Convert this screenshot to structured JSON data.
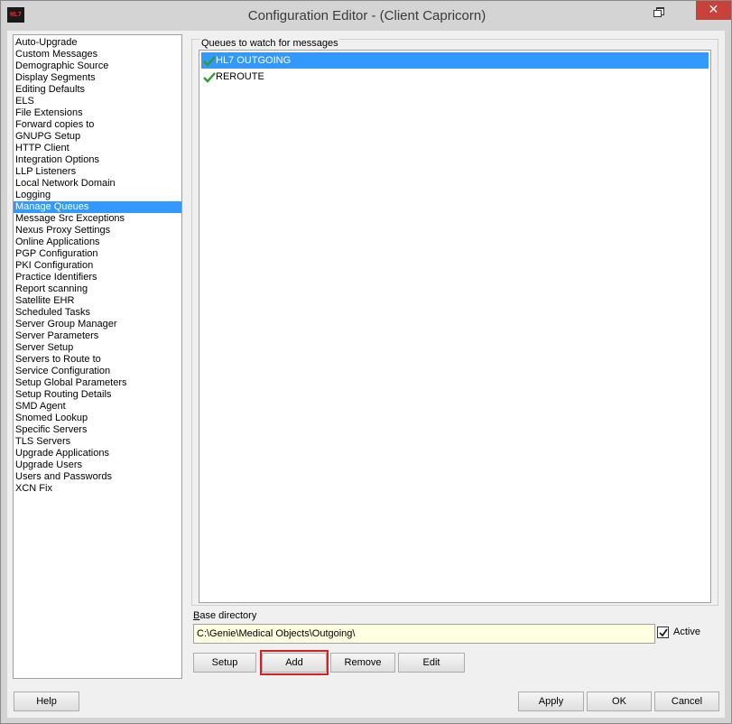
{
  "window": {
    "title": "Configuration Editor -  (Client Capricorn)",
    "app_icon_text": "HL7",
    "close_glyph": "✕"
  },
  "sidebar": {
    "selected_index": 14,
    "items": [
      "Auto-Upgrade",
      "Custom Messages",
      "Demographic Source",
      "Display Segments",
      "Editing Defaults",
      "ELS",
      "File Extensions",
      "Forward copies to",
      "GNUPG Setup",
      "HTTP Client",
      "Integration Options",
      "LLP Listeners",
      "Local Network Domain",
      "Logging",
      "Manage Queues",
      "Message Src Exceptions",
      "Nexus Proxy Settings",
      "Online Applications",
      "PGP Configuration",
      "PKI Configuration",
      "Practice Identifiers",
      "Report scanning",
      "Satellite EHR",
      "Scheduled Tasks",
      "Server Group Manager",
      "Server Parameters",
      "Server Setup",
      "Servers to Route to",
      "Service Configuration",
      "Setup Global Parameters",
      "Setup Routing Details",
      "SMD Agent",
      "Snomed Lookup",
      "Specific Servers",
      "TLS Servers",
      "Upgrade Applications",
      "Upgrade Users",
      "Users and Passwords",
      "XCN Fix"
    ]
  },
  "queues": {
    "group_label": "Queues to watch for messages",
    "items": [
      {
        "label": "HL7 OUTGOING",
        "checked": true,
        "selected": true
      },
      {
        "label": "REROUTE",
        "checked": true,
        "selected": false
      }
    ]
  },
  "base_directory": {
    "label_first": "B",
    "label_rest": "ase directory",
    "value": "C:\\Genie\\Medical Objects\\Outgoing\\",
    "active_label": "Active",
    "active_checked": true
  },
  "actions": {
    "setup": "Setup",
    "add": "Add",
    "remove": "Remove",
    "edit": "Edit"
  },
  "footer": {
    "help": "Help",
    "apply": "Apply",
    "ok": "OK",
    "cancel": "Cancel"
  },
  "colors": {
    "selection": "#3399ff",
    "input_bg": "#ffffe1",
    "close_button": "#c7423a",
    "highlight": "#d42020",
    "check_green": "#2e9e2e"
  }
}
